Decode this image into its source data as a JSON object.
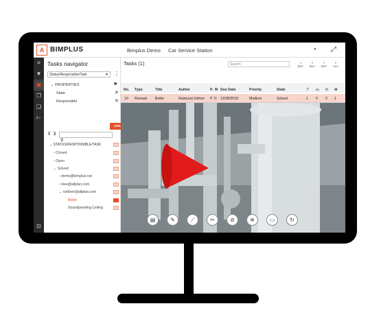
{
  "app": {
    "logo_letter": "A",
    "name": "BIMPLUS",
    "project": "Bimplus Demo",
    "model": "Car Service Station"
  },
  "header_icons": [
    "speedometer-icon",
    "expand-icon"
  ],
  "sidebar_icons": [
    "layers-icon",
    "filter-icon",
    "tasks-icon",
    "copy-icon",
    "clone-icon",
    "hierarchy-icon",
    "cart-icon"
  ],
  "navigator": {
    "title": "Tasks navigator",
    "grouping_value": "Status/Responsible/Task",
    "properties_label": "PROPERTIES",
    "properties": [
      "State",
      "Responsible"
    ],
    "create_label": "CREATE",
    "tree_header": "STATUS/RESPONSIBLE/TASK",
    "tree": [
      {
        "label": "Closed",
        "prefix": "›"
      },
      {
        "label": "Open",
        "prefix": "›"
      },
      {
        "label": "Solved",
        "prefix": "⌄"
      },
      {
        "label": "demo@bimplus.net",
        "prefix": "›"
      },
      {
        "label": "klee@allplan.com",
        "prefix": "›"
      },
      {
        "label": "rzellner@allplan.com",
        "prefix": "⌄"
      },
      {
        "label": "Boiler",
        "prefix": ""
      },
      {
        "label": "Soundproofing Ceiling",
        "prefix": ""
      }
    ]
  },
  "tasks": {
    "title": "Tasks (1)",
    "search_placeholder": "Search",
    "bcf_buttons": [
      "BCF",
      "BCF",
      "BCF",
      "XLS"
    ],
    "columns": [
      "No.",
      "Type",
      "Title",
      "Author",
      "P.",
      "M",
      "Due Date",
      "Priority",
      "State"
    ],
    "row": {
      "no": "10",
      "type": "Remark",
      "title": "Boiler",
      "author": "Raimund Zellner",
      "p": "P",
      "m": "0:",
      "due": "12/28/2018",
      "priority": "Medium",
      "state": "Solved",
      "c1": "1",
      "c2": "0",
      "c3": "2",
      "c4": "1"
    }
  },
  "view_tools": [
    "clipboard-icon",
    "edit-icon",
    "ruler-icon",
    "cut-icon",
    "hide-icon",
    "layers-icon",
    "camera-icon",
    "refresh-icon"
  ],
  "colors": {
    "accent": "#e8502a",
    "sidebar": "#2b2b2b"
  }
}
